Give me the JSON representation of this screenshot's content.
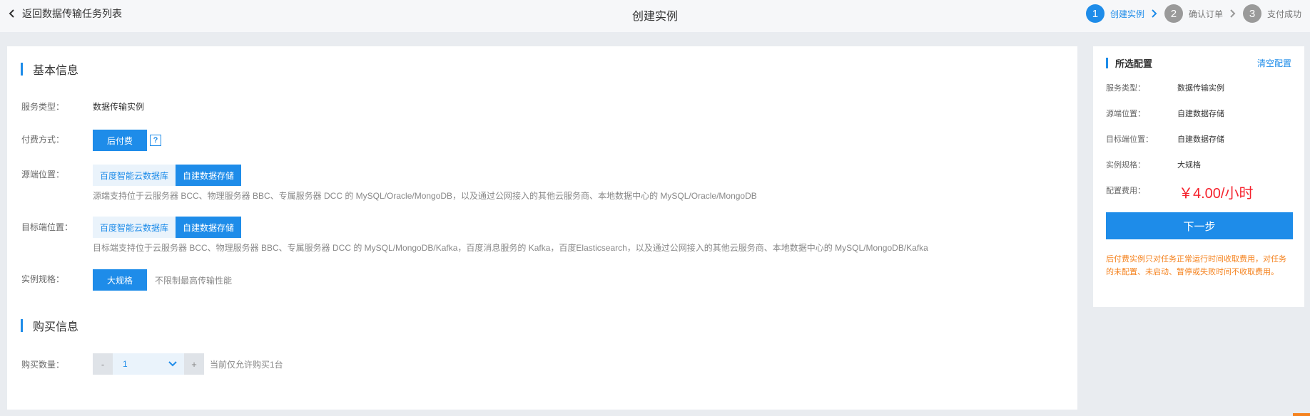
{
  "header": {
    "back_label": "返回数据传输任务列表",
    "title": "创建实例",
    "steps": [
      {
        "num": "1",
        "label": "创建实例",
        "active": true
      },
      {
        "num": "2",
        "label": "确认订单",
        "active": false
      },
      {
        "num": "3",
        "label": "支付成功",
        "active": false
      }
    ]
  },
  "basic": {
    "section_title": "基本信息",
    "service_type_label": "服务类型：",
    "service_type_value": "数据传输实例",
    "billing_label": "付费方式：",
    "billing_value": "后付费",
    "help_symbol": "?",
    "source_label": "源端位置：",
    "source_options": [
      "百度智能云数据库",
      "自建数据存储"
    ],
    "source_selected": 1,
    "source_hint": "源端支持位于云服务器 BCC、物理服务器 BBC、专属服务器 DCC 的 MySQL/Oracle/MongoDB，以及通过公网接入的其他云服务商、本地数据中心的 MySQL/Oracle/MongoDB",
    "target_label": "目标端位置：",
    "target_options": [
      "百度智能云数据库",
      "自建数据存储"
    ],
    "target_selected": 1,
    "target_hint": "目标端支持位于云服务器 BCC、物理服务器 BBC、专属服务器 DCC 的 MySQL/MongoDB/Kafka，百度消息服务的 Kafka，百度Elasticsearch，以及通过公网接入的其他云服务商、本地数据中心的 MySQL/MongoDB/Kafka",
    "spec_label": "实例规格：",
    "spec_value": "大规格",
    "spec_note": "不限制最高传输性能"
  },
  "purchase": {
    "section_title": "购买信息",
    "quantity_label": "购买数量：",
    "minus": "-",
    "plus": "+",
    "quantity_value": "1",
    "quantity_note": "当前仅允许购买1台"
  },
  "summary": {
    "title": "所选配置",
    "clear_label": "清空配置",
    "rows": [
      {
        "label": "服务类型：",
        "value": "数据传输实例"
      },
      {
        "label": "源端位置：",
        "value": "自建数据存储"
      },
      {
        "label": "目标端位置：",
        "value": "自建数据存储"
      },
      {
        "label": "实例规格：",
        "value": "大规格"
      }
    ],
    "fee_label": "配置费用：",
    "price": "￥4.00/小时",
    "next_label": "下一步",
    "note": "后付费实例只对任务正常运行时间收取费用，对任务的未配置、未启动、暂停或失败时间不收取费用。"
  },
  "colors": {
    "accent": "#1e8ce9",
    "price": "#f5222d",
    "warning": "#f5831f"
  }
}
